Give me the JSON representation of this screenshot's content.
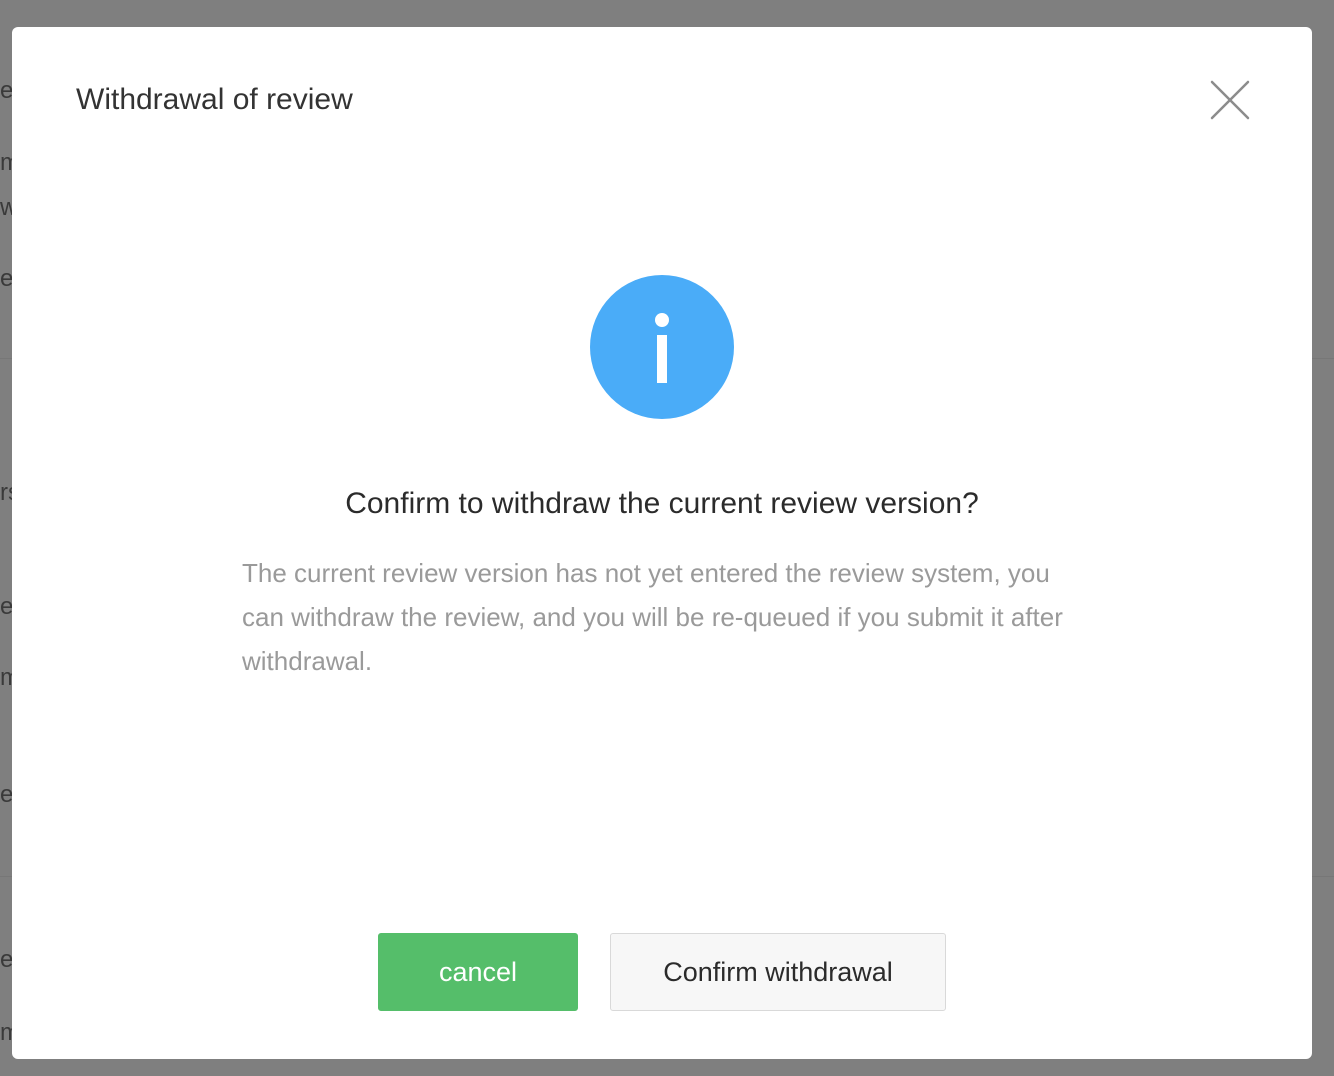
{
  "dialog": {
    "title": "Withdrawal of review",
    "close_icon": "close-icon",
    "info_icon": "info-icon",
    "heading": "Confirm to withdraw the current review version?",
    "description": "The current review version has not yet entered the review system, you can withdraw the review, and you will be re-queued if you submit it after withdrawal.",
    "cancel_label": "cancel",
    "confirm_label": "Confirm withdrawal"
  },
  "background": {
    "fragments": [
      "el",
      "m",
      "w",
      "ec",
      "rs",
      "el",
      "m",
      "ec",
      "el",
      "m"
    ]
  },
  "colors": {
    "overlay": "#7f7f7f",
    "info_blue": "#4aacf8",
    "cancel_green": "#55be6a",
    "description_gray": "#9a9a9a"
  }
}
